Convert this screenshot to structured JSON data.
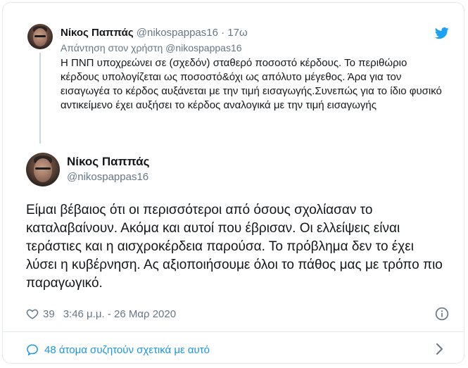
{
  "parent": {
    "name": "Νίκος Παππάς",
    "handle": "@nikospappas16",
    "dot": "·",
    "time": "17ω",
    "reply_to": "Απάντηση στον χρήστη @nikospappas16",
    "text": "Η ΠΝΠ υποχρεώνει σε (σχεδόν) σταθερό ποσοστό κέρδους. Το περιθώριο κέρδους υπολογίζεται ως ποσοστό&όχι ως απόλυτο μέγεθος. Άρα για τον εισαγωγέα το κέρδος αυξάνεται με την τιμή εισαγωγής.Συνεπώς για το ίδιο φυσικό αντικείμενο έχει αυξήσει το κέρδος αναλογικά με την τιμή εισαγωγής"
  },
  "main": {
    "name": "Νίκος Παππάς",
    "handle": "@nikospappas16",
    "text": "Είμαι βέβαιος ότι οι περισσότεροι από όσους σχολίασαν το καταλαβαίνουν. Ακόμα και αυτοί που έβρισαν. Οι ελλείψεις είναι τεράστιες και η αισχροκέρδεια παρούσα. Το πρόβλημα δεν το έχει λύσει η κυβέρνηση. Ας αξιοποιήσουμε όλοι το πάθος μας με τρόπο πιο παραγωγικό.",
    "likes": "39",
    "timestamp": "3:46 μ.μ. - 26 Μαρ 2020"
  },
  "discussion": {
    "label": "48 άτομα συζητούν σχετικά με αυτό"
  },
  "icons": {
    "brand": "twitter-bird-icon",
    "like": "heart-icon",
    "info": "info-icon",
    "discuss": "speech-bubble-icon",
    "chevron": "chevron-right-icon"
  },
  "colors": {
    "accent": "#1da1f2",
    "link": "#1b95e0",
    "muted": "#657786",
    "text": "#14171a",
    "border": "#e1e8ed"
  }
}
